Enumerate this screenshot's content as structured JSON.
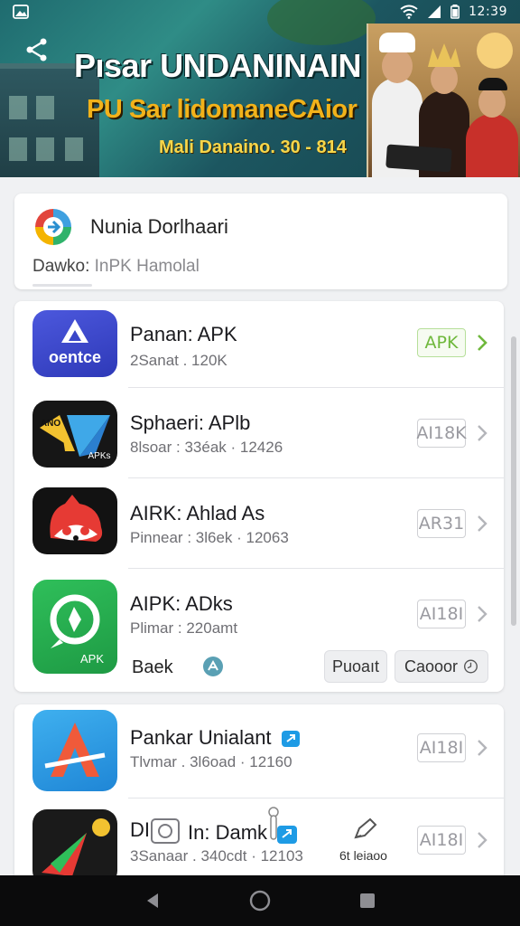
{
  "status_bar": {
    "time": "12:39"
  },
  "banner": {
    "title": "Pısar UNDANINAIN",
    "subtitle": "PU Sar lidomaneCAior",
    "tagline": "Mali Danaino. 30 - 814"
  },
  "header": {
    "title": "Nunia Dorlhaari",
    "sub_label": "Dawko:",
    "sub_value": "InPK Hamolal"
  },
  "apps": [
    {
      "name": "Panan: APK",
      "meta": "2Sanat . 120K",
      "badge": "APK",
      "badge_style": "green",
      "icon": "a-letter-icon"
    },
    {
      "name": "Sphaeri: APlb",
      "meta": "8lsoar : 33éak · 12426",
      "badge": "AI18K",
      "badge_style": "gray",
      "icon": "apk-arrow-icon",
      "icon_text_top": "ANO",
      "icon_text_bottom": "APKs"
    },
    {
      "name": "AIRK: Ahlad As",
      "meta": "Pinnear : 3l6ek · 12063",
      "badge": "AR31",
      "badge_style": "gray",
      "icon": "ghost-cat-icon"
    },
    {
      "name": "AIPK: ADks",
      "meta": "Plimar : 220amt",
      "badge": "AI18I",
      "badge_style": "gray",
      "icon": "apk-refresh-icon",
      "icon_text": "APK"
    }
  ],
  "row4_actions": {
    "back_label": "Baek",
    "primary_label": "Puoaıt",
    "secondary_label": "Caooor"
  },
  "apps2": [
    {
      "name": "Pankar Unialant",
      "meta": "Tlvmar . 3l6oad · 12160",
      "badge": "AI18I",
      "badge_style": "gray",
      "icon": "a-triangle-icon"
    },
    {
      "name": "DI",
      "name2": "In: Damk",
      "meta": "3Sanaar . 340cdt · 12103",
      "badge": "AI18I",
      "badge_style": "gray",
      "icon": "paper-plane-icon"
    }
  ],
  "overlay": {
    "label": "6t leiaoo"
  }
}
